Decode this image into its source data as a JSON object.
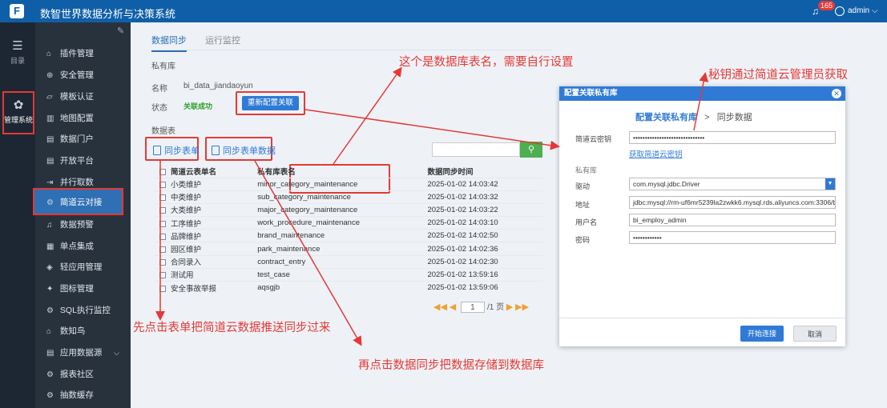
{
  "app": {
    "title": "数智世界数据分析与决策系统",
    "notifications": "165",
    "user": "admin"
  },
  "rail": [
    {
      "label": "目录",
      "icon": "list-icon"
    },
    {
      "label": "管理系统",
      "icon": "gear-icon"
    }
  ],
  "sidebar": {
    "items": [
      {
        "label": "插件管理",
        "icon": "plugin-icon"
      },
      {
        "label": "安全管理",
        "icon": "shield-icon"
      },
      {
        "label": "模板认证",
        "icon": "template-icon"
      },
      {
        "label": "地图配置",
        "icon": "map-icon"
      },
      {
        "label": "数据门户",
        "icon": "portal-icon"
      },
      {
        "label": "开放平台",
        "icon": "platform-icon"
      },
      {
        "label": "并行取数",
        "icon": "parallel-icon"
      },
      {
        "label": "简道云对接",
        "icon": "link-icon"
      },
      {
        "label": "数据预警",
        "icon": "bell-icon"
      },
      {
        "label": "单点集成",
        "icon": "sso-icon"
      },
      {
        "label": "轻应用管理",
        "icon": "app-icon"
      },
      {
        "label": "图标管理",
        "icon": "image-icon"
      },
      {
        "label": "SQL执行监控",
        "icon": "sql-icon"
      },
      {
        "label": "数知鸟",
        "icon": "bird-icon"
      },
      {
        "label": "应用数据源",
        "icon": "datasource-icon"
      },
      {
        "label": "报表社区",
        "icon": "community-icon"
      },
      {
        "label": "抽数缓存",
        "icon": "cache-icon"
      }
    ]
  },
  "tabs": [
    "数据同步",
    "运行监控"
  ],
  "private_db": {
    "section": "私有库",
    "name_label": "名称",
    "name_value": "bi_data_jiandaoyun",
    "status_label": "状态",
    "status_value": "关联成功",
    "reconfig_button": "重新配置关联"
  },
  "tables": {
    "section": "数据表",
    "sync_form": "同步表单",
    "sync_form_data": "同步表单数据",
    "search_icon": "search-icon",
    "columns": [
      "简道云表单名",
      "私有库表名",
      "数据同步时间"
    ],
    "rows": [
      [
        "小类维护",
        "minor_category_maintenance",
        "2025-01-02 14:03:42"
      ],
      [
        "中类维护",
        "sub_category_maintenance",
        "2025-01-02 14:03:32"
      ],
      [
        "大类维护",
        "major_category_maintenance",
        "2025-01-02 14:03:22"
      ],
      [
        "工序维护",
        "work_procedure_maintenance",
        "2025-01-02 14:03:10"
      ],
      [
        "品牌维护",
        "brand_maintenance",
        "2025-01-02 14:02:50"
      ],
      [
        "园区维护",
        "park_maintenance",
        "2025-01-02 14:02:36"
      ],
      [
        "合同录入",
        "contract_entry",
        "2025-01-02 14:02:30"
      ],
      [
        "测试用",
        "test_case",
        "2025-01-02 13:59:16"
      ],
      [
        "安全事故举报",
        "aqsgjb",
        "2025-01-02 13:59:06"
      ]
    ],
    "pager": {
      "page": "1",
      "total": "/1 页"
    }
  },
  "dialog": {
    "title": "配置关联私有库",
    "step1": "配置关联私有库",
    "step_sep": ">",
    "step2": "同步数据",
    "secret_label": "简道云密钥",
    "secret_value": "••••••••••••••••••••••••••••••",
    "secret_link": "获取简道云密钥",
    "private_section": "私有库",
    "driver_label": "驱动",
    "driver_value": "com.mysql.jdbc.Driver",
    "url_label": "地址",
    "url_value": "jdbc:mysql://rm-uf6mr5239la2zwkk6.mysql.rds.aliyuncs.com:3306/bi_...",
    "user_label": "用户名",
    "user_value": "bi_employ_admin",
    "pwd_label": "密码",
    "pwd_value": "••••••••••••",
    "connect_button": "开始连接",
    "cancel_button": "取消"
  },
  "annotations": {
    "a1": "这个是数据库表名，需要自行设置",
    "a2": "秘钥通过简道云管理员获取",
    "a3": "先点击表单把简道云数据推送同步过来",
    "a4": "再点击数据同步把数据存储到数据库"
  },
  "colors": {
    "topbar": "#0f5fa8",
    "accent": "#2f7ad6",
    "annotation": "#e53935",
    "success": "#2e9e2e"
  }
}
